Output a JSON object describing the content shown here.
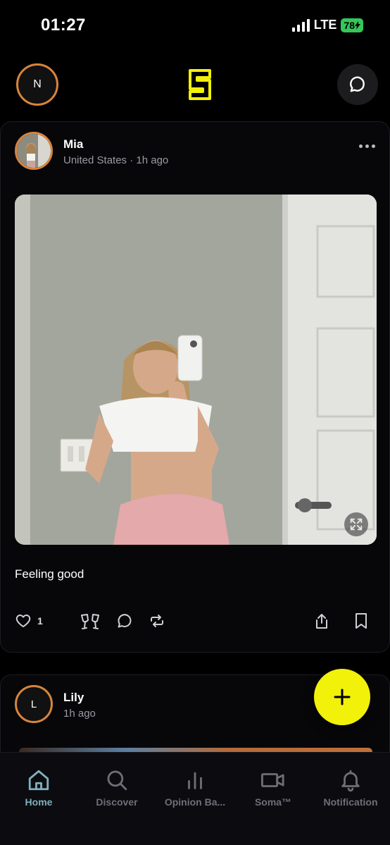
{
  "status": {
    "time": "01:27",
    "network": "LTE",
    "battery": "78"
  },
  "header": {
    "user_initial": "N",
    "logo_letter": "S"
  },
  "posts": [
    {
      "author": "Mia",
      "meta": "United States · 1h ago",
      "caption": "Feeling good",
      "likes": "1"
    },
    {
      "author": "Lily",
      "avatar_initial": "L",
      "meta": "1h ago"
    }
  ],
  "tabs": [
    {
      "label": "Home",
      "icon": "home-icon",
      "active": true
    },
    {
      "label": "Discover",
      "icon": "search-icon"
    },
    {
      "label": "Opinion Ba...",
      "icon": "bar-chart-icon"
    },
    {
      "label": "Soma™",
      "icon": "video-camera-icon"
    },
    {
      "label": "Notification",
      "icon": "bell-icon"
    }
  ],
  "colors": {
    "accent_yellow": "#f1f10a",
    "avatar_ring": "#d8843c",
    "active_tab": "#7fb1bd",
    "battery": "#34c759"
  }
}
